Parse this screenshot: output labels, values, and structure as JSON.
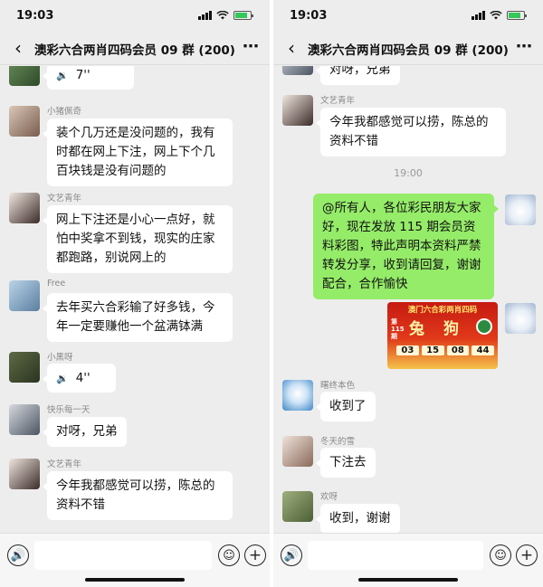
{
  "status": {
    "time": "19:03"
  },
  "header": {
    "title": "澳彩六合两肖四码会员 09 群 (200)",
    "back_icon": "chevron-left-icon",
    "more_icon": "more-icon"
  },
  "left": {
    "voice1": {
      "duration": "7''"
    },
    "msg1": {
      "nick": "小猪佩奇",
      "text": "装个几万还是没问题的，我有时都在网上下注，网上下个几百块钱是没有问题的"
    },
    "msg2": {
      "nick": "文艺青年",
      "text": "网上下注还是小心一点好，就怕中奖拿不到钱，现实的庄家都跑路，别说网上的"
    },
    "msg3": {
      "nick": "Free",
      "text": "去年买六合彩输了好多钱，今年一定要赚他一个盆满钵满"
    },
    "msg4": {
      "nick": "小黑呀",
      "duration": "4''"
    },
    "msg5": {
      "nick": "快乐每一天",
      "text": "对呀，兄弟"
    },
    "msg6": {
      "nick": "文艺青年",
      "text": "今年我都感觉可以捞，陈总的资料不错"
    }
  },
  "right": {
    "prev_text": "对呀，兄弟",
    "msg1": {
      "nick": "文艺青年",
      "text": "今年我都感觉可以捞，陈总的资料不错"
    },
    "timestamp": "19:00",
    "self_text": "@所有人，各位彩民朋友大家好，现在发放 115 期会员资料彩图，特此声明本资料严禁转发分享，收到请回复，谢谢配合，合作愉快",
    "image": {
      "banner": "澳门六合彩两肖四码",
      "issue": "第115期",
      "zodiac1": "兔",
      "zodiac2": "狗",
      "numbers": [
        "03",
        "15",
        "08",
        "44"
      ]
    },
    "msg2": {
      "nick": "曙终本色",
      "text": "收到了"
    },
    "msg3": {
      "nick": "冬天的雪",
      "text": "下注去"
    },
    "msg4": {
      "nick": "欢呀",
      "text": "收到，谢谢"
    }
  },
  "colors": {
    "background": "#ededed",
    "self_bubble": "#95ec69",
    "other_bubble": "#ffffff"
  }
}
